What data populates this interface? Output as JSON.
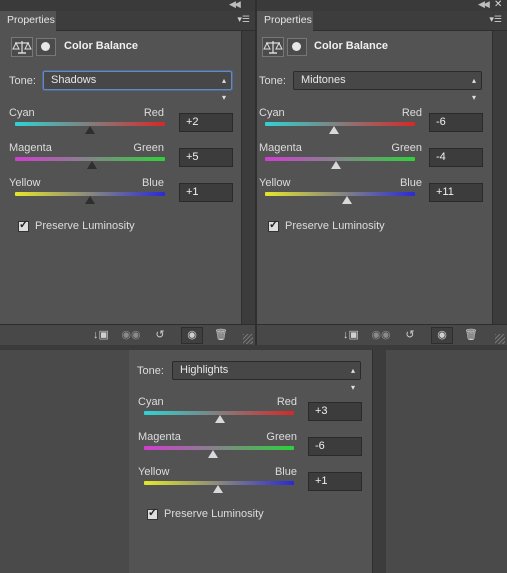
{
  "panel_tab": "Properties",
  "adjustment_title": "Color Balance",
  "tone_label": "Tone:",
  "preserve_luminosity_label": "Preserve Luminosity",
  "slider_labels": {
    "cyan": "Cyan",
    "red": "Red",
    "magenta": "Magenta",
    "green": "Green",
    "yellow": "Yellow",
    "blue": "Blue"
  },
  "icons": {
    "collapse": "double-chevron-left-icon",
    "close": "close-icon",
    "menu": "panel-menu-icon",
    "adjustment": "scale-balance-icon",
    "mask": "layer-mask-icon",
    "clip": "clip-to-layer-icon",
    "view_previous": "view-previous-state-icon",
    "reset": "reset-icon",
    "visibility": "eye-icon",
    "delete": "trash-icon"
  },
  "colors": {
    "panel_bg": "#535353",
    "cyan_red": [
      "#2fd3d3",
      "#d62828"
    ],
    "magenta_green": [
      "#d23cd2",
      "#2ed23a"
    ],
    "yellow_blue": [
      "#e6e62a",
      "#2a2ad6"
    ]
  },
  "panels": {
    "shadows": {
      "tone": "Shadows",
      "cyan_red": "+2",
      "magenta_green": "+5",
      "yellow_blue": "+1",
      "preserve_luminosity": true
    },
    "midtones": {
      "tone": "Midtones",
      "cyan_red": "-6",
      "magenta_green": "-4",
      "yellow_blue": "+11",
      "preserve_luminosity": true
    },
    "highlights": {
      "tone": "Highlights",
      "cyan_red": "+3",
      "magenta_green": "-6",
      "yellow_blue": "+1",
      "preserve_luminosity": true
    }
  }
}
